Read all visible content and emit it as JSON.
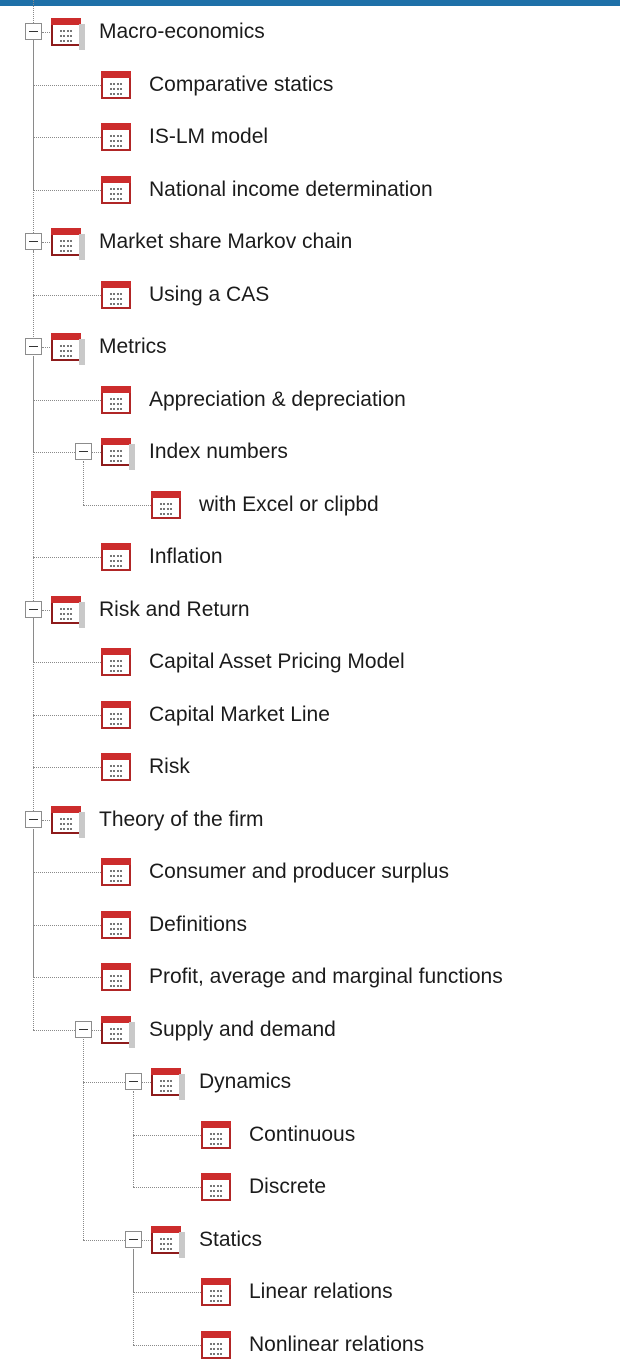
{
  "tree": [
    {
      "label": "Macro-economics",
      "depth": 0,
      "expanded": true,
      "children": [
        {
          "label": "Comparative statics",
          "depth": 1
        },
        {
          "label": "IS-LM model",
          "depth": 1
        },
        {
          "label": "National income determination",
          "depth": 1
        }
      ]
    },
    {
      "label": "Market share Markov chain",
      "depth": 0,
      "expanded": true,
      "children": [
        {
          "label": "Using a CAS",
          "depth": 1
        }
      ]
    },
    {
      "label": "Metrics",
      "depth": 0,
      "expanded": true,
      "children": [
        {
          "label": "Appreciation & depreciation",
          "depth": 1
        },
        {
          "label": "Index numbers",
          "depth": 1,
          "expanded": true,
          "children": [
            {
              "label": "with Excel or clipbd",
              "depth": 2
            }
          ]
        },
        {
          "label": "Inflation",
          "depth": 1
        }
      ]
    },
    {
      "label": "Risk and Return",
      "depth": 0,
      "expanded": true,
      "children": [
        {
          "label": "Capital Asset Pricing Model",
          "depth": 1
        },
        {
          "label": "Capital Market Line",
          "depth": 1
        },
        {
          "label": "Risk",
          "depth": 1
        }
      ]
    },
    {
      "label": "Theory of the firm",
      "depth": 0,
      "expanded": true,
      "children": [
        {
          "label": "Consumer and producer surplus",
          "depth": 1
        },
        {
          "label": "Definitions",
          "depth": 1
        },
        {
          "label": "Profit, average and marginal functions",
          "depth": 1
        },
        {
          "label": "Supply and demand",
          "depth": 1,
          "expanded": true,
          "children": [
            {
              "label": "Dynamics",
              "depth": 2,
              "expanded": true,
              "children": [
                {
                  "label": "Continuous",
                  "depth": 3
                },
                {
                  "label": "Discrete",
                  "depth": 3
                }
              ]
            },
            {
              "label": "Statics",
              "depth": 2,
              "expanded": true,
              "children": [
                {
                  "label": "Linear relations",
                  "depth": 3
                },
                {
                  "label": "Nonlinear relations",
                  "depth": 3
                }
              ]
            }
          ]
        }
      ]
    }
  ]
}
